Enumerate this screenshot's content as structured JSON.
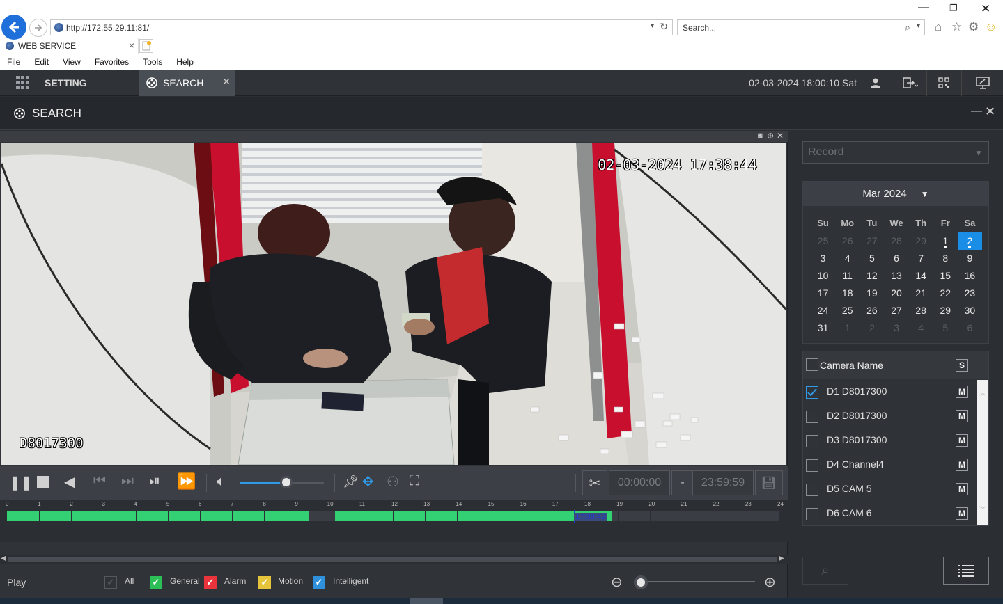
{
  "browser": {
    "url": "http://172.55.29.11:81/",
    "search_placeholder": "Search...",
    "tab_title": "WEB SERVICE",
    "menu": [
      "File",
      "Edit",
      "View",
      "Favorites",
      "Tools",
      "Help"
    ]
  },
  "app": {
    "setting_label": "SETTING",
    "search_tab_label": "SEARCH",
    "datetime": "02-03-2024 18:00:10 Sat",
    "page_title": "SEARCH"
  },
  "video": {
    "osd_time": "02-03-2024 17:38:44",
    "osd_name": "D8017300"
  },
  "controls": {
    "volume": 0.55,
    "clip_start": "00:00:00",
    "clip_separator": "-",
    "clip_end": "23:59:59"
  },
  "timeline": {
    "hours": [
      "0",
      "1",
      "2",
      "3",
      "4",
      "5",
      "6",
      "7",
      "8",
      "9",
      "10",
      "11",
      "12",
      "13",
      "14",
      "15",
      "16",
      "17",
      "18",
      "19",
      "20",
      "21",
      "22",
      "23",
      "24"
    ],
    "recorded_ranges": [
      [
        0,
        9.4
      ],
      [
        10.2,
        18.8
      ]
    ],
    "cursor_hour": 17.64,
    "cursor_label": "17:38:43"
  },
  "legend": {
    "play_label": "Play",
    "items": [
      {
        "label": "All",
        "color": "#3a3d42",
        "checked": false
      },
      {
        "label": "General",
        "color": "#2bbf55",
        "checked": true
      },
      {
        "label": "Alarm",
        "color": "#e8343a",
        "checked": true
      },
      {
        "label": "Motion",
        "color": "#e7c53a",
        "checked": true
      },
      {
        "label": "Intelligent",
        "color": "#2f90dc",
        "checked": true
      }
    ]
  },
  "side": {
    "record_type": "Record",
    "calendar": {
      "month_label": "Mar 2024",
      "weekdays": [
        "Su",
        "Mo",
        "Tu",
        "We",
        "Th",
        "Fr",
        "Sa"
      ],
      "days": [
        {
          "d": "25",
          "m": true
        },
        {
          "d": "26",
          "m": true
        },
        {
          "d": "27",
          "m": true
        },
        {
          "d": "28",
          "m": true
        },
        {
          "d": "29",
          "m": true
        },
        {
          "d": "1",
          "dot": true
        },
        {
          "d": "2",
          "sel": true,
          "dot": true
        },
        {
          "d": "3"
        },
        {
          "d": "4"
        },
        {
          "d": "5"
        },
        {
          "d": "6"
        },
        {
          "d": "7"
        },
        {
          "d": "8"
        },
        {
          "d": "9"
        },
        {
          "d": "10"
        },
        {
          "d": "11"
        },
        {
          "d": "12"
        },
        {
          "d": "13"
        },
        {
          "d": "14"
        },
        {
          "d": "15"
        },
        {
          "d": "16"
        },
        {
          "d": "17"
        },
        {
          "d": "18"
        },
        {
          "d": "19"
        },
        {
          "d": "20"
        },
        {
          "d": "21"
        },
        {
          "d": "22"
        },
        {
          "d": "23"
        },
        {
          "d": "24"
        },
        {
          "d": "25"
        },
        {
          "d": "26"
        },
        {
          "d": "27"
        },
        {
          "d": "28"
        },
        {
          "d": "29"
        },
        {
          "d": "30"
        },
        {
          "d": "31"
        },
        {
          "d": "1",
          "m": true
        },
        {
          "d": "2",
          "m": true
        },
        {
          "d": "3",
          "m": true
        },
        {
          "d": "4",
          "m": true
        },
        {
          "d": "5",
          "m": true
        },
        {
          "d": "6",
          "m": true
        }
      ]
    },
    "camera_header": "Camera Name",
    "s_button": "S",
    "m_button": "M",
    "cameras": [
      {
        "name": "D1 D8017300",
        "checked": true
      },
      {
        "name": "D2 D8017300",
        "checked": false
      },
      {
        "name": "D3 D8017300",
        "checked": false
      },
      {
        "name": "D4 Channel4",
        "checked": false
      },
      {
        "name": "D5 CAM 5",
        "checked": false
      },
      {
        "name": "D6 CAM 6",
        "checked": false
      }
    ]
  }
}
